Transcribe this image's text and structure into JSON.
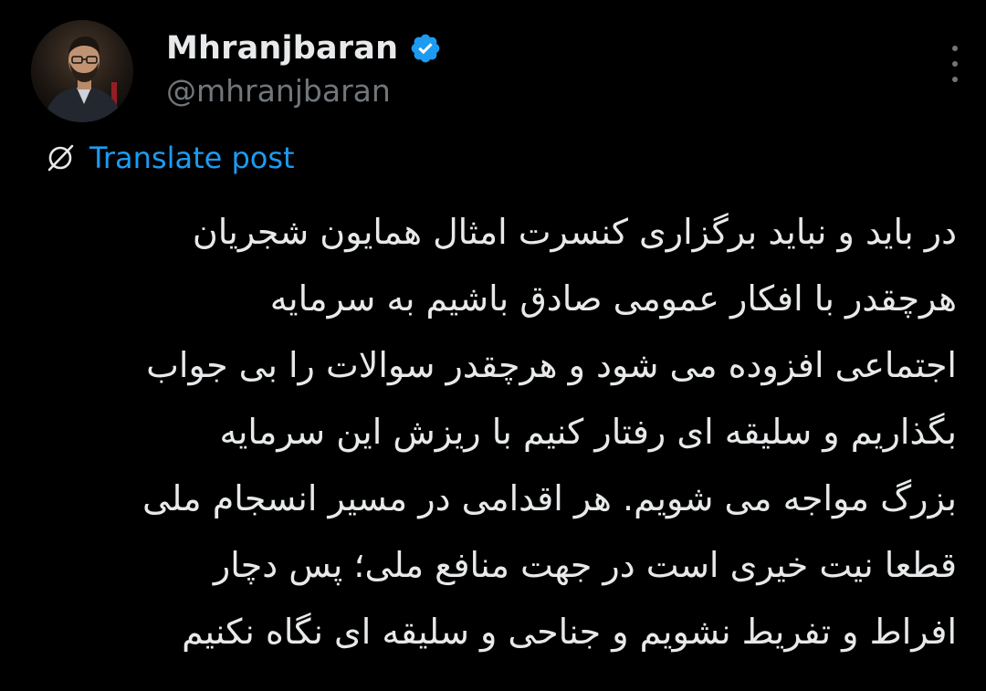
{
  "author": {
    "display_name": "Mhranjbaran",
    "handle": "@mhranjbaran",
    "verified": true,
    "avatar_icon": "avatar-photo"
  },
  "actions": {
    "more_icon": "more-vertical-icon",
    "translate_label": "Translate post",
    "translate_icon": "translate-globe-icon"
  },
  "post": {
    "lines": [
      "در باید و نباید برگزاری کنسرت امثال همایون شجریان",
      "هرچقدر با افکار عمومی صادق باشیم به سرمایه",
      "اجتماعی افزوده می شود و هرچقدر سوالات را بی جواب",
      "بگذاریم و سلیقه ای رفتار کنیم با ریزش این سرمایه",
      "بزرگ مواجه می شویم. هر اقدامی در مسیر انسجام ملی",
      "قطعا نیت خیری است در جهت منافع ملی؛ پس دچار",
      "افراط و تفریط نشویم و جناحی و سلیقه ای نگاه نکنیم"
    ]
  },
  "colors": {
    "background": "#000000",
    "text_primary": "#e7e9ea",
    "text_secondary": "#71767b",
    "accent": "#1d9bf0"
  }
}
